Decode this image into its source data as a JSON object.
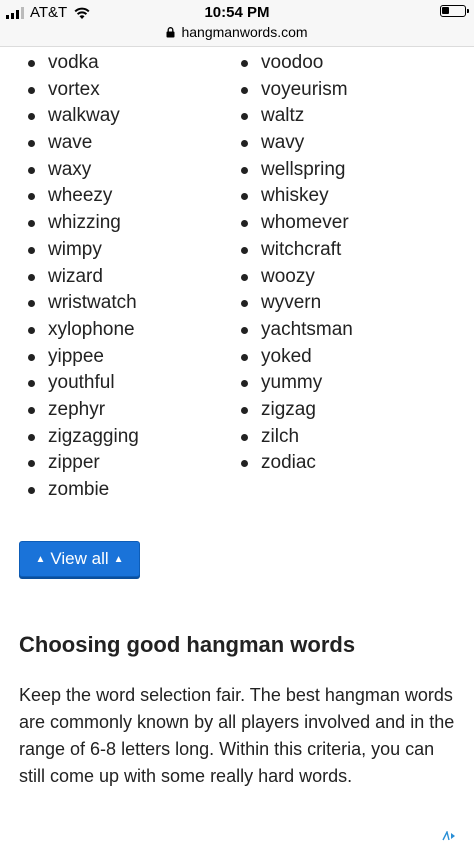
{
  "status_bar": {
    "carrier": "AT&T",
    "time": "10:54 PM",
    "url": "hangmanwords.com",
    "battery_level": 0.35
  },
  "word_list": {
    "left": [
      "vodka",
      "vortex",
      "walkway",
      "wave",
      "waxy",
      "wheezy",
      "whizzing",
      "wimpy",
      "wizard",
      "wristwatch",
      "xylophone",
      "yippee",
      "youthful",
      "zephyr",
      "zigzagging",
      "zipper",
      "zombie"
    ],
    "right": [
      "voodoo",
      "voyeurism",
      "waltz",
      "wavy",
      "wellspring",
      "whiskey",
      "whomever",
      "witchcraft",
      "woozy",
      "wyvern",
      "yachtsman",
      "yoked",
      "yummy",
      "zigzag",
      "zilch",
      "zodiac"
    ]
  },
  "view_all": {
    "label": "View all",
    "icon_left": "▲",
    "icon_right": "▲"
  },
  "section": {
    "heading": "Choosing good hangman words",
    "body": "Keep the word selection fair. The best hangman words are commonly known by all players involved and in the range of 6-8 letters long. Within this criteria, you can still come up with some really hard words."
  },
  "colors": {
    "button": "#1a73d9",
    "text": "#222222",
    "status_bg": "#f7f7f7"
  }
}
